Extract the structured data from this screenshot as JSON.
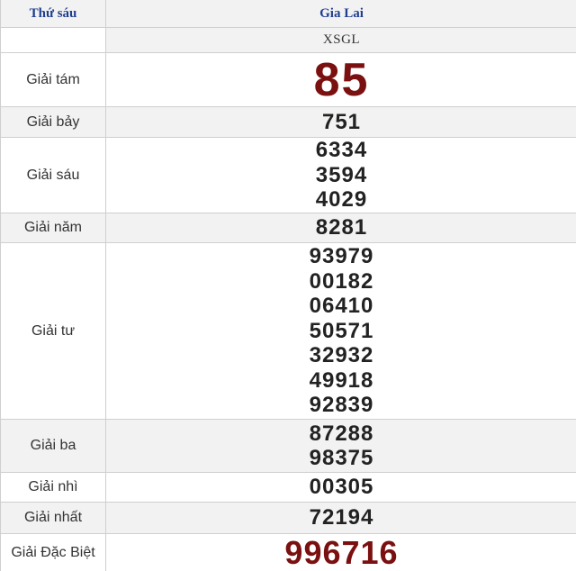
{
  "header": {
    "day": "Thứ sáu",
    "province": "Gia Lai"
  },
  "code": "XSGL",
  "prizes": [
    {
      "label": "Giải tám",
      "numbers": [
        "85"
      ]
    },
    {
      "label": "Giải bảy",
      "numbers": [
        "751"
      ]
    },
    {
      "label": "Giải sáu",
      "numbers": [
        "6334",
        "3594",
        "4029"
      ]
    },
    {
      "label": "Giải năm",
      "numbers": [
        "8281"
      ]
    },
    {
      "label": "Giải tư",
      "numbers": [
        "93979",
        "00182",
        "06410",
        "50571",
        "32932",
        "49918",
        "92839"
      ]
    },
    {
      "label": "Giải ba",
      "numbers": [
        "87288",
        "98375"
      ]
    },
    {
      "label": "Giải nhì",
      "numbers": [
        "00305"
      ]
    },
    {
      "label": "Giải nhất",
      "numbers": [
        "72194"
      ]
    },
    {
      "label": "Giải Đặc Biệt",
      "numbers": [
        "996716"
      ]
    }
  ],
  "colors": {
    "header_text": "#1f3f8f",
    "highlight": "#7a1010",
    "border": "#cfcfcf",
    "shade": "#f2f2f2"
  }
}
